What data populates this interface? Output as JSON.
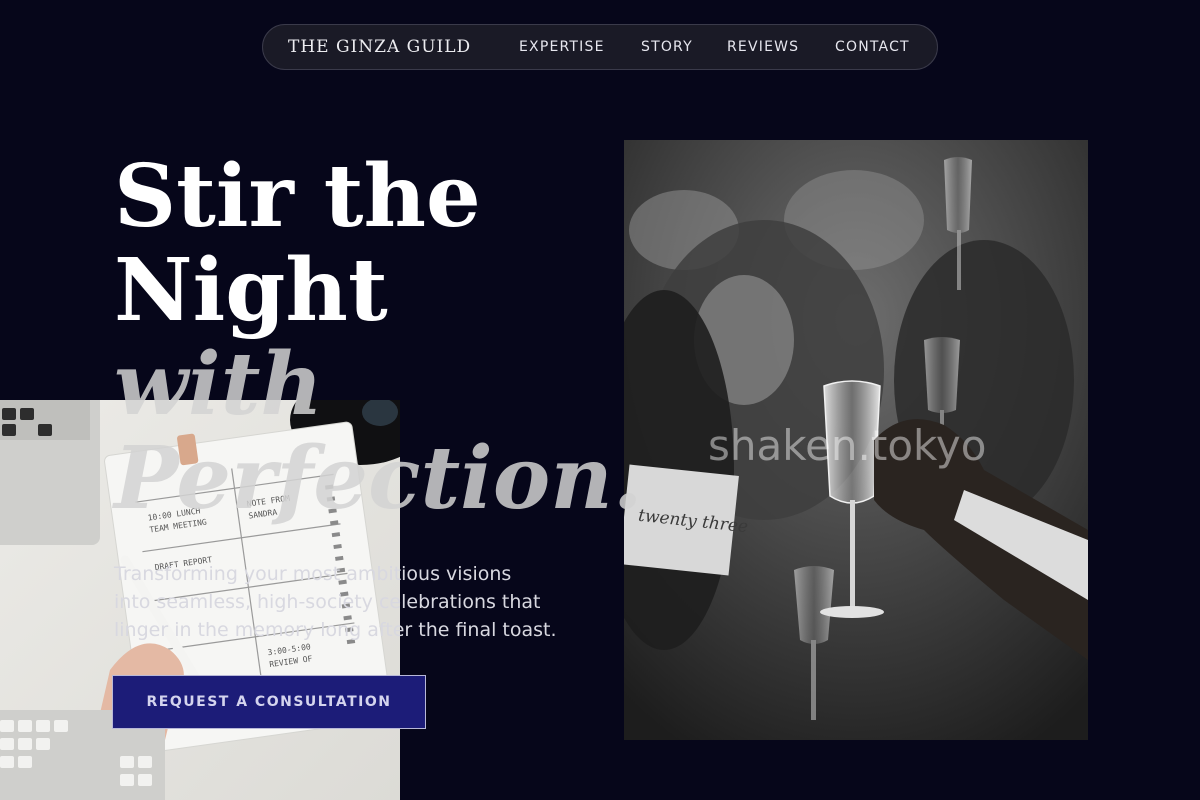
{
  "nav": {
    "brand": "THE GINZA GUILD",
    "links": [
      "EXPERTISE",
      "STORY",
      "REVIEWS",
      "CONTACT"
    ]
  },
  "hero": {
    "headline_line1": "Stir the",
    "headline_line2": "Night",
    "headline_line3": "with",
    "headline_line4": "Perfection.",
    "lede_line1": "Transforming your most ambitious visions",
    "lede_line2": "into seamless, high-society celebrations that",
    "lede_line3": "linger in the memory long after the final toast.",
    "cta": "REQUEST A CONSULTATION"
  },
  "photo": {
    "watermark": "shaken.tokyo",
    "place_card": "twenty three"
  },
  "colors": {
    "background": "#06061a",
    "nav_pill": "#1a1a26",
    "cta_fill": "#1c1c78"
  }
}
